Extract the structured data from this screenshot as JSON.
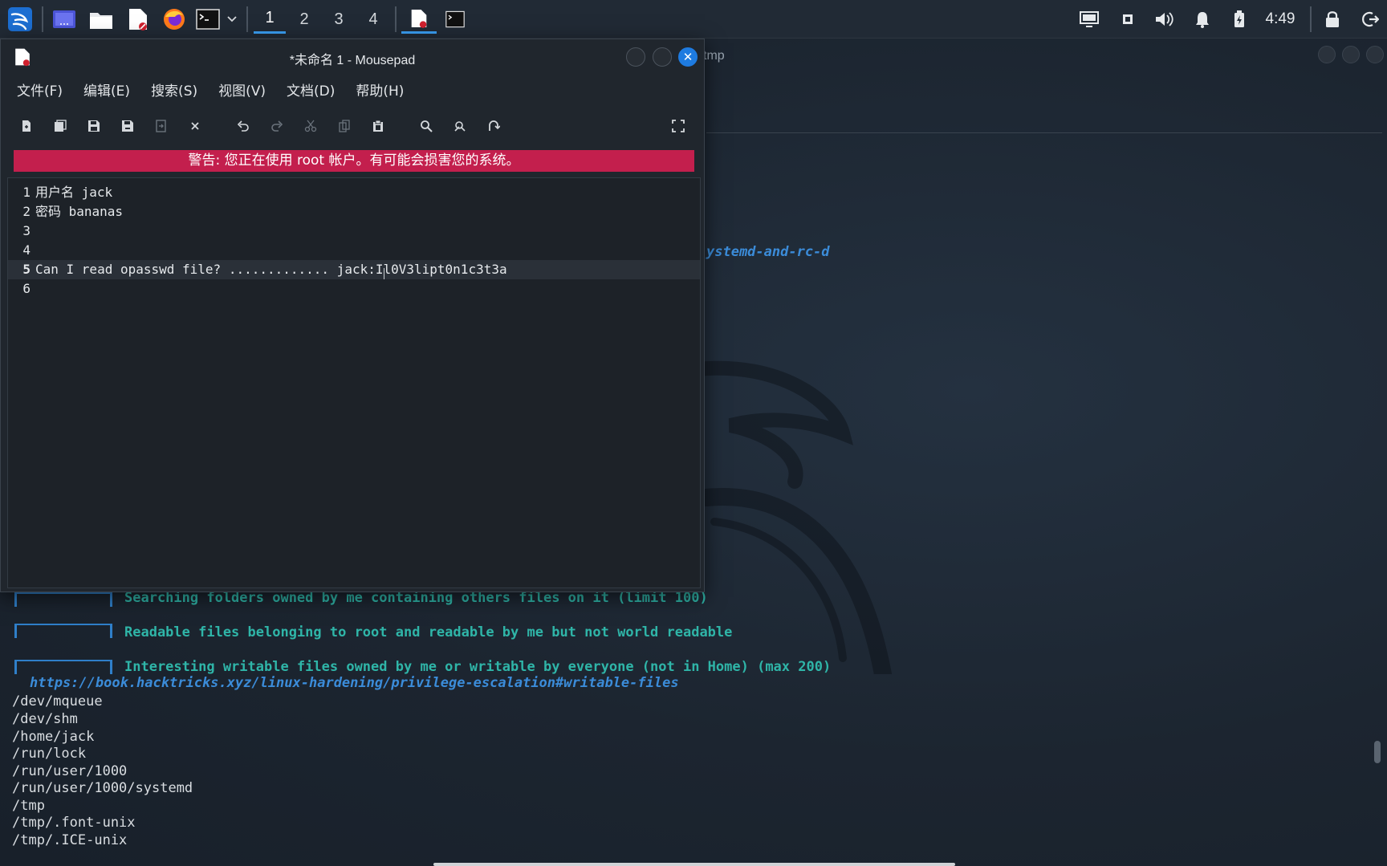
{
  "taskbar": {
    "workspaces": [
      "1",
      "2",
      "3",
      "4"
    ],
    "active_workspace": "1",
    "clock": "4:49",
    "icons": [
      "kali-menu-icon",
      "desktop-icon",
      "file-manager-icon",
      "text-editor-icon",
      "firefox-icon",
      "terminal-icon",
      "chevron-down-icon",
      "mousepad-task-icon",
      "terminal-task-icon",
      "display-icon",
      "network-icon",
      "volume-icon",
      "notification-bell-icon",
      "battery-icon",
      "lock-icon",
      "logout-icon"
    ]
  },
  "mousepad": {
    "title": "*未命名 1 - Mousepad",
    "menus": [
      "文件(F)",
      "编辑(E)",
      "搜索(S)",
      "视图(V)",
      "文档(D)",
      "帮助(H)"
    ],
    "toolbar": [
      "new-document-icon",
      "new-window-icon",
      "save-icon",
      "save-as-icon",
      "reload-icon",
      "close-tab-icon",
      "undo-icon",
      "redo-icon",
      "cut-icon",
      "copy-icon",
      "paste-icon",
      "find-icon",
      "find-replace-icon",
      "goto-icon",
      "fullscreen-icon"
    ],
    "warning": "警告: 您正在使用 root 帐户。有可能会损害您的系统。",
    "lines": [
      {
        "num": "1",
        "text": "用户名 jack"
      },
      {
        "num": "2",
        "text": "密码 bananas"
      },
      {
        "num": "3",
        "text": ""
      },
      {
        "num": "4",
        "text": ""
      },
      {
        "num": "5",
        "text": "Can I read opasswd file? ............. jack:Il0V3lipt0n1c3t3a"
      },
      {
        "num": "6",
        "text": ""
      }
    ],
    "current_line": "5"
  },
  "terminal": {
    "title_fragment": "tmp",
    "link_top": "ystemd-and-rc-d",
    "section_1": "Searching folders owned by me containing others files on it (limit 100)",
    "section_2": "Readable files belonging to root and readable by me but not world readable",
    "section_3": "Interesting writable files owned by me or writable by everyone (not in Home) (max 200)",
    "link": "https://book.hacktricks.xyz/linux-hardening/privilege-escalation#writable-files",
    "paths": [
      "/dev/mqueue",
      "/dev/shm",
      "/home/jack",
      "/run/lock",
      "/run/user/1000",
      "/run/user/1000/systemd",
      "/tmp",
      "/tmp/.font-unix",
      "/tmp/.ICE-unix"
    ]
  },
  "colors": {
    "accent": "#3a9ff5",
    "warning_bg": "#c31f4d",
    "section_head": "#2fb5a8",
    "link": "#3b8cd9"
  }
}
